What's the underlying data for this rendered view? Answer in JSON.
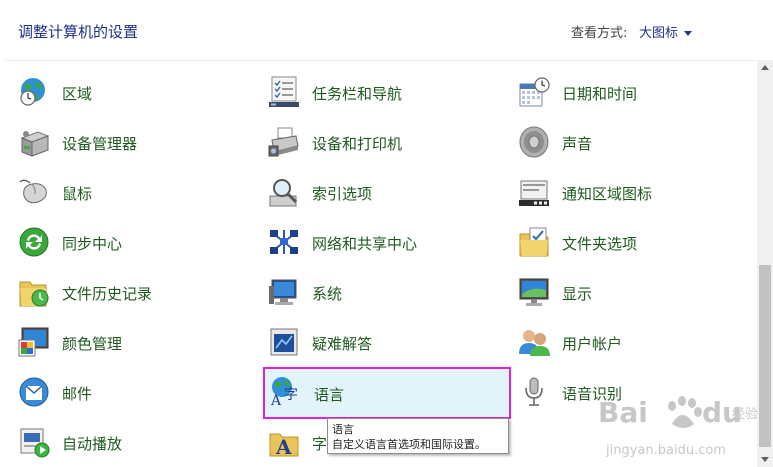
{
  "header": {
    "title": "调整计算机的设置",
    "view_label": "查看方式:",
    "view_value": "大图标"
  },
  "items": [
    {
      "label": "区域",
      "icon": "globe-clock-icon"
    },
    {
      "label": "任务栏和导航",
      "icon": "taskbar-icon"
    },
    {
      "label": "日期和时间",
      "icon": "calendar-clock-icon"
    },
    {
      "label": "设备管理器",
      "icon": "device-manager-icon"
    },
    {
      "label": "设备和打印机",
      "icon": "printer-icon"
    },
    {
      "label": "声音",
      "icon": "speaker-icon"
    },
    {
      "label": "鼠标",
      "icon": "mouse-icon"
    },
    {
      "label": "索引选项",
      "icon": "magnifier-icon"
    },
    {
      "label": "通知区域图标",
      "icon": "notification-area-icon"
    },
    {
      "label": "同步中心",
      "icon": "sync-icon"
    },
    {
      "label": "网络和共享中心",
      "icon": "network-icon"
    },
    {
      "label": "文件夹选项",
      "icon": "folder-check-icon"
    },
    {
      "label": "文件历史记录",
      "icon": "file-history-icon"
    },
    {
      "label": "系统",
      "icon": "system-icon"
    },
    {
      "label": "显示",
      "icon": "display-icon"
    },
    {
      "label": "颜色管理",
      "icon": "color-management-icon"
    },
    {
      "label": "疑难解答",
      "icon": "troubleshoot-icon"
    },
    {
      "label": "用户帐户",
      "icon": "user-accounts-icon"
    },
    {
      "label": "邮件",
      "icon": "mail-icon"
    },
    {
      "label": "语言",
      "icon": "language-icon"
    },
    {
      "label": "语音识别",
      "icon": "microphone-icon"
    },
    {
      "label": "自动播放",
      "icon": "autoplay-icon"
    },
    {
      "label": "字",
      "icon": "fonts-icon"
    }
  ],
  "tooltip": {
    "title": "语言",
    "description": "自定义语言首选项和国际设置。"
  },
  "watermark": {
    "brand": "Bai du 经验",
    "url": "jingyan.baidu.com"
  }
}
